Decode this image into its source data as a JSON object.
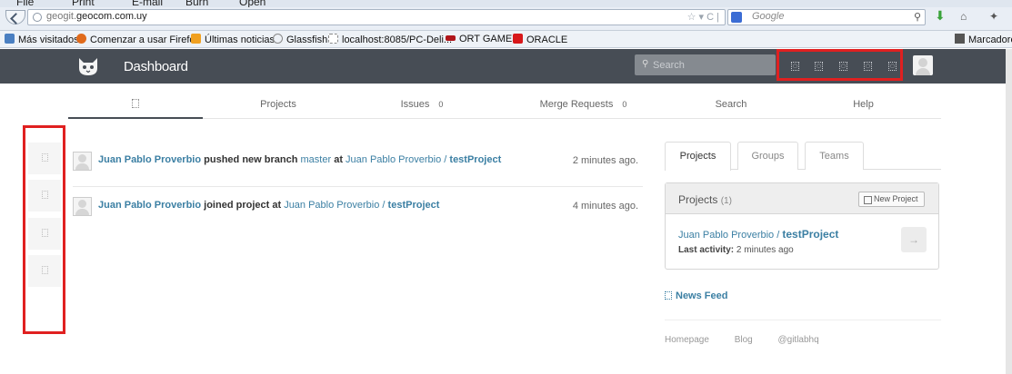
{
  "browser": {
    "menu": [
      "File",
      "Print",
      "E-mail",
      "Burn",
      "Open"
    ],
    "url_prefix": "geogit.",
    "url_domain": "geocom.com.uy",
    "search_engine_placeholder": "Google",
    "bookmarks": [
      {
        "label": "Más visitados",
        "color": "#4a7fc1"
      },
      {
        "label": "Comenzar a usar Firefox",
        "color": "#e06a1b"
      },
      {
        "label": "Últimas noticias",
        "color": "#f0a020"
      },
      {
        "label": "Glassfish",
        "color": "#888888"
      },
      {
        "label": "localhost:8085/PC-Deli...",
        "color": "#ffffff"
      },
      {
        "label": "ORT GAMES",
        "color": "#b0151a"
      },
      {
        "label": "ORACLE",
        "color": "#d8181a"
      }
    ],
    "bookmarks_right": "Marcadore"
  },
  "header": {
    "title": "Dashboard",
    "search_placeholder": "Search",
    "icon_names": [
      "admin-icon",
      "new-project-icon",
      "profile-icon",
      "settings-icon",
      "logout-icon"
    ]
  },
  "tabs": {
    "projects": "Projects",
    "issues": "Issues",
    "issues_count": "0",
    "merge_requests": "Merge Requests",
    "merge_requests_count": "0",
    "search": "Search",
    "help": "Help"
  },
  "events": [
    {
      "author": "Juan Pablo Proverbio",
      "action": "pushed new branch",
      "branch": "master",
      "at": "at",
      "project_owner": "Juan Pablo Proverbio /",
      "project_name": "testProject",
      "time": "2 minutes ago."
    },
    {
      "author": "Juan Pablo Proverbio",
      "action": "joined project",
      "at": "at",
      "project_owner": "Juan Pablo Proverbio /",
      "project_name": "testProject",
      "time": "4 minutes ago."
    }
  ],
  "right_tabs": [
    "Projects",
    "Groups",
    "Teams"
  ],
  "projects_panel": {
    "title": "Projects",
    "count": "(1)",
    "new_project": "New Project",
    "project_owner": "Juan Pablo Proverbio /",
    "project_name": "testProject",
    "last_activity_label": "Last activity:",
    "last_activity_value": "2 minutes ago",
    "arrow": "→"
  },
  "news_feed": "News Feed",
  "footer": [
    "Homepage",
    "Blog",
    "@gitlabhq"
  ],
  "colors": {
    "header_bg": "#474d55",
    "link": "#3b7fa3",
    "highlight_box": "#e02020"
  }
}
